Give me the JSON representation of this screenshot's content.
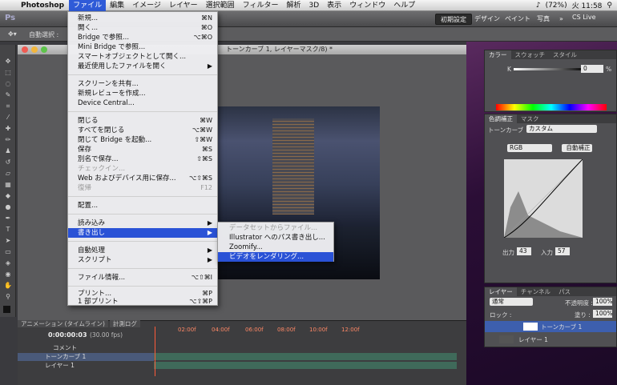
{
  "menubar": {
    "app": "Photoshop",
    "items": [
      "ファイル",
      "編集",
      "イメージ",
      "レイヤー",
      "選択範囲",
      "フィルター",
      "解析",
      "3D",
      "表示",
      "ウィンドウ",
      "ヘルプ"
    ],
    "battery": "(72%)",
    "clock": "火 11:58"
  },
  "appbar": {
    "ps": "Ps",
    "workspaces": [
      "初期設定",
      "デザイン",
      "ペイント",
      "写真"
    ],
    "more": "»",
    "cslive": "CS Live"
  },
  "options": {
    "auto_select": "自動選択 :"
  },
  "document": {
    "title": "トーンカーブ 1, レイヤーマスク/8) *"
  },
  "file_menu": {
    "items": [
      {
        "label": "新規...",
        "shortcut": "⌘N"
      },
      {
        "label": "開く...",
        "shortcut": "⌘O"
      },
      {
        "label": "Bridge で参照...",
        "shortcut": "⌥⌘O"
      },
      {
        "label": "Mini Bridge で参照...",
        "shortcut": ""
      },
      {
        "label": "スマートオブジェクトとして開く...",
        "shortcut": ""
      },
      {
        "label": "最近使用したファイルを開く",
        "shortcut": "▶"
      },
      {
        "label": "スクリーンを共有...",
        "shortcut": ""
      },
      {
        "label": "新規レビューを作成...",
        "shortcut": ""
      },
      {
        "label": "Device Central...",
        "shortcut": ""
      },
      {
        "label": "閉じる",
        "shortcut": "⌘W"
      },
      {
        "label": "すべてを閉じる",
        "shortcut": "⌥⌘W"
      },
      {
        "label": "閉じて Bridge を起動...",
        "shortcut": "⇧⌘W"
      },
      {
        "label": "保存",
        "shortcut": "⌘S"
      },
      {
        "label": "別名で保存...",
        "shortcut": "⇧⌘S"
      },
      {
        "label": "チェックイン...",
        "shortcut": ""
      },
      {
        "label": "Web およびデバイス用に保存...",
        "shortcut": "⌥⇧⌘S"
      },
      {
        "label": "復帰",
        "shortcut": "F12"
      },
      {
        "label": "配置...",
        "shortcut": ""
      },
      {
        "label": "読み込み",
        "shortcut": "▶"
      },
      {
        "label": "書き出し",
        "shortcut": "▶"
      },
      {
        "label": "自動処理",
        "shortcut": "▶"
      },
      {
        "label": "スクリプト",
        "shortcut": "▶"
      },
      {
        "label": "ファイル情報...",
        "shortcut": "⌥⇧⌘I"
      },
      {
        "label": "プリント...",
        "shortcut": "⌘P"
      },
      {
        "label": "1 部プリント",
        "shortcut": "⌥⇧⌘P"
      }
    ]
  },
  "export_submenu": {
    "items": [
      "データセットからファイル...",
      "Illustrator へのパス書き出し...",
      "Zoomify...",
      "ビデオをレンダリング..."
    ]
  },
  "panels": {
    "color_tabs": [
      "カラー",
      "スウォッチ",
      "スタイル"
    ],
    "color_k": "K",
    "color_value": "0",
    "color_pct": "%",
    "adjust_tabs": [
      "色調補正",
      "マスク"
    ],
    "curves_label": "トーンカーブ",
    "curves_preset": "カスタム",
    "channel": "RGB",
    "auto": "自動補正",
    "output_label": "出力 :",
    "output_value": "43",
    "input_label": "入力 :",
    "input_value": "57",
    "layers_tabs": [
      "レイヤー",
      "チャンネル",
      "パス"
    ],
    "blend": "通常",
    "opacity_label": "不透明度 :",
    "opacity": "100%",
    "lock_label": "ロック :",
    "fill_label": "塗り :",
    "fill": "100%",
    "layers": [
      "トーンカーブ 1",
      "レイヤー 1"
    ]
  },
  "timeline": {
    "tabs": [
      "アニメーション (タイムライン)",
      "計測ログ"
    ],
    "timecode": "0:00:00:03",
    "fps": "(30.00 fps)",
    "ticks": [
      "02:00f",
      "04:00f",
      "06:00f",
      "08:00f",
      "10:00f",
      "12:00f"
    ],
    "rows": [
      "コメント",
      "トーンカーブ 1",
      "レイヤー 1"
    ]
  },
  "colors": {
    "highlight": "#2a52d6",
    "menubar_active": "#2f5bd8"
  }
}
